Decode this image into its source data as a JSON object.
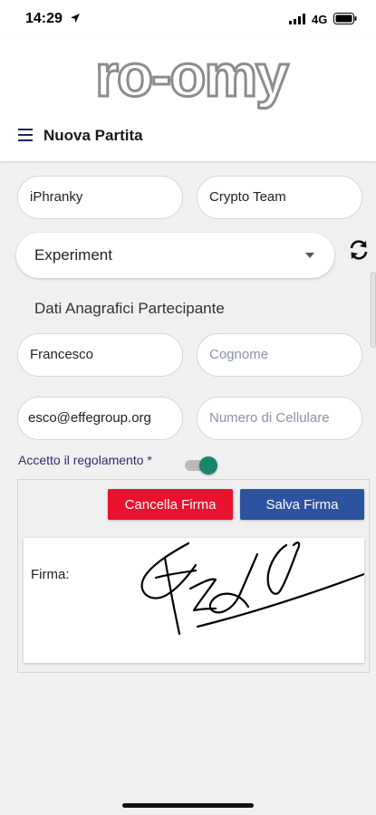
{
  "status_bar": {
    "time": "14:29",
    "network": "4G"
  },
  "header": {
    "logo_text": "ro-omy",
    "title": "Nuova Partita"
  },
  "form": {
    "player_name": "iPhranky",
    "team_name": "Crypto Team",
    "game_select": "Experiment",
    "section_title": "Dati Anagrafici Partecipante",
    "first_name": "Francesco",
    "last_name_placeholder": "Cognome",
    "email": "esco@effegroup.org",
    "phone_placeholder": "Numero di Cellulare",
    "rules_label": "Accetto il regolamento *",
    "rules_accepted": true
  },
  "signature": {
    "cancel_label": "Cancella Firma",
    "save_label": "Salva Firma",
    "field_label": "Firma:"
  },
  "colors": {
    "cancel": "#e8122e",
    "save": "#2d53a0",
    "toggle": "#18866a",
    "menu": "#1d2a5a"
  }
}
